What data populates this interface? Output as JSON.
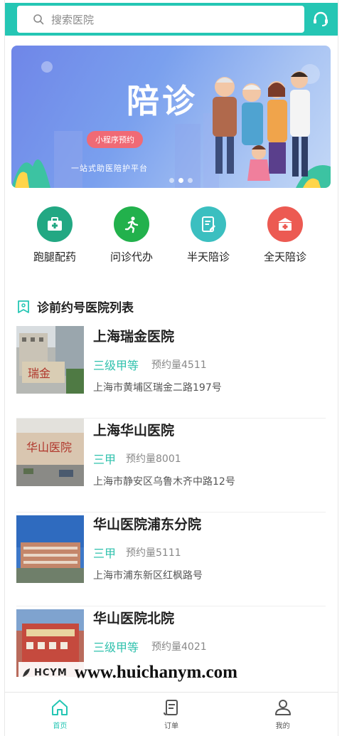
{
  "search": {
    "placeholder": "搜索医院"
  },
  "banner": {
    "title": "陪诊",
    "pill": "小程序预约",
    "subtitle": "一站式助医陪护平台"
  },
  "categories": [
    {
      "label": "跑腿配药",
      "icon": "medicine-bag-icon",
      "color": "#22a883"
    },
    {
      "label": "问诊代办",
      "icon": "running-person-icon",
      "color": "#22b14c"
    },
    {
      "label": "半天陪诊",
      "icon": "clipboard-icon",
      "color": "#3bbfc0"
    },
    {
      "label": "全天陪诊",
      "icon": "first-aid-kit-icon",
      "color": "#ec5a52"
    }
  ],
  "section": {
    "title": "诊前约号医院列表"
  },
  "hospitals": [
    {
      "name": "上海瑞金医院",
      "level": "三级甲等",
      "count": "预约量4511",
      "address": "上海市黄埔区瑞金二路197号"
    },
    {
      "name": "上海华山医院",
      "level": "三甲",
      "count": "预约量8001",
      "address": "上海市静安区乌鲁木齐中路12号"
    },
    {
      "name": "华山医院浦东分院",
      "level": "三甲",
      "count": "预约量5111",
      "address": "上海市浦东新区红枫路号"
    },
    {
      "name": "华山医院北院",
      "level": "三级甲等",
      "count": "预约量4021",
      "address": ""
    }
  ],
  "watermark": {
    "logo": "HCYM",
    "url": "www.huichanym.com"
  },
  "nav": [
    {
      "label": "首页",
      "icon": "home-icon"
    },
    {
      "label": "订单",
      "icon": "order-icon"
    },
    {
      "label": "我的",
      "icon": "user-icon"
    }
  ],
  "colors": {
    "accent": "#25c6b4",
    "text": "#222222",
    "muted": "#888888"
  }
}
